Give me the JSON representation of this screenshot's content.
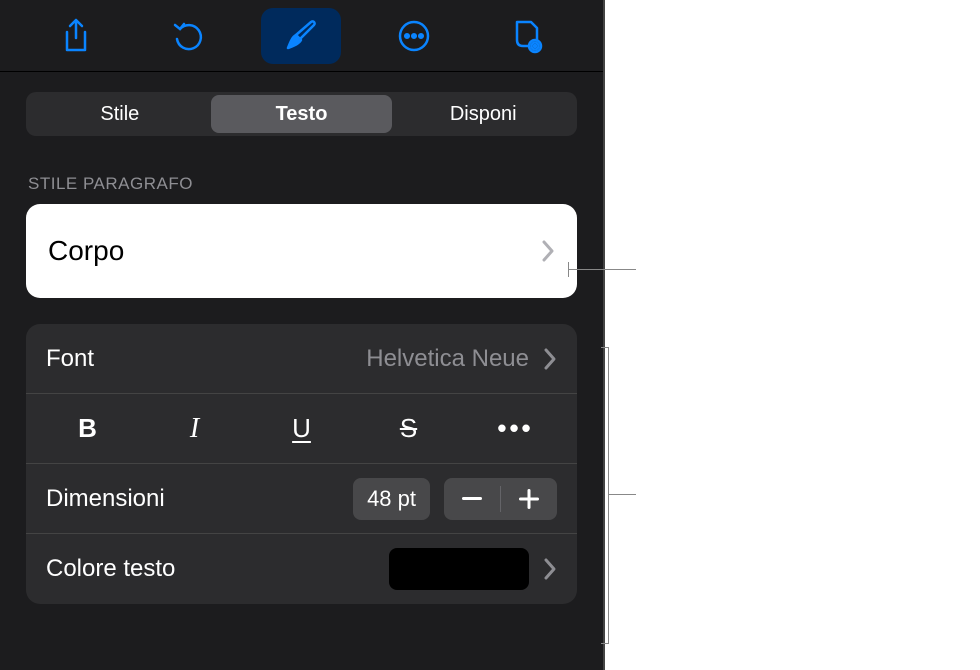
{
  "tabs": {
    "style": "Stile",
    "text": "Testo",
    "arrange": "Disponi"
  },
  "section": {
    "paragraphStyle": "STILE PARAGRAFO"
  },
  "paragraphStyle": {
    "value": "Corpo"
  },
  "font": {
    "label": "Font",
    "value": "Helvetica Neue"
  },
  "formatButtons": {
    "bold": "B",
    "italic": "I",
    "underline": "U",
    "strike": "S",
    "more": "•••"
  },
  "size": {
    "label": "Dimensioni",
    "value": "48 pt"
  },
  "textColor": {
    "label": "Colore testo",
    "value": "#000000"
  },
  "colors": {
    "accent": "#0a84ff"
  }
}
